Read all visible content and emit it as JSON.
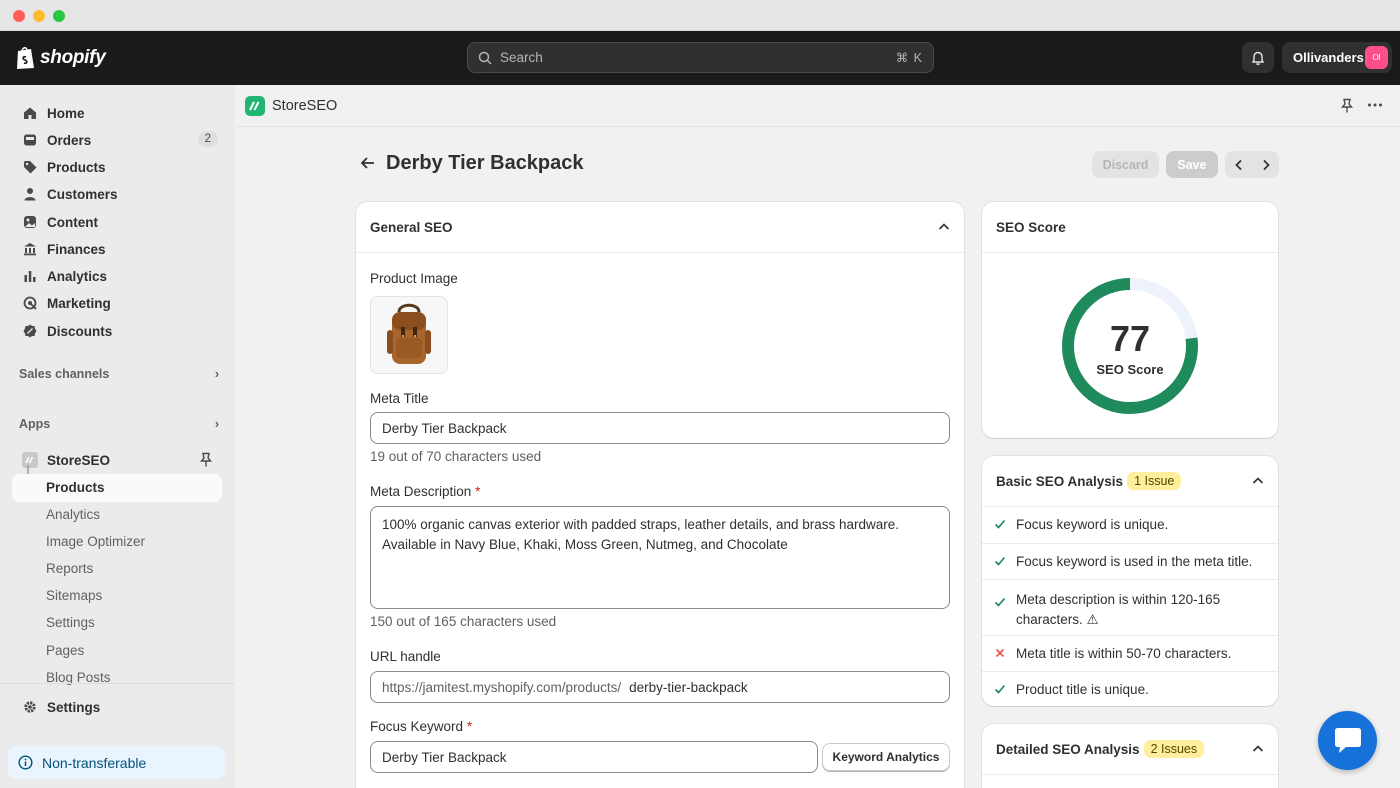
{
  "topbar": {
    "logo_text": "shopify",
    "search_placeholder": "Search",
    "search_shortcut": "⌘ K",
    "store_name": "Ollivanders",
    "avatar_initials": "Ol"
  },
  "sidebar": {
    "items": [
      {
        "label": "Home",
        "icon": "home-icon"
      },
      {
        "label": "Orders",
        "icon": "orders-icon",
        "badge": "2"
      },
      {
        "label": "Products",
        "icon": "tag-icon"
      },
      {
        "label": "Customers",
        "icon": "person-icon"
      },
      {
        "label": "Content",
        "icon": "content-icon"
      },
      {
        "label": "Finances",
        "icon": "bank-icon"
      },
      {
        "label": "Analytics",
        "icon": "bar-chart-icon"
      },
      {
        "label": "Marketing",
        "icon": "target-icon"
      },
      {
        "label": "Discounts",
        "icon": "discount-icon"
      }
    ],
    "sales_channels": "Sales channels",
    "apps": "Apps",
    "app_name": "StoreSEO",
    "app_subitems": [
      "Products",
      "Analytics",
      "Image Optimizer",
      "Reports",
      "Sitemaps",
      "Settings",
      "Pages",
      "Blog Posts"
    ],
    "settings": "Settings",
    "non_transferable": "Non-transferable"
  },
  "app_header": {
    "title": "StoreSEO"
  },
  "page": {
    "title": "Derby Tier Backpack",
    "discard": "Discard",
    "save": "Save"
  },
  "general_seo": {
    "heading": "General SEO",
    "product_image_label": "Product Image",
    "meta_title_label": "Meta Title",
    "meta_title_value": "Derby Tier Backpack",
    "meta_title_help": "19 out of 70 characters used",
    "meta_desc_label": "Meta Description",
    "meta_desc_value": "100% organic canvas exterior with padded straps, leather details, and brass hardware. Available in Navy Blue, Khaki, Moss Green, Nutmeg, and Chocolate",
    "meta_desc_help": "150 out of 165 characters used",
    "url_label": "URL handle",
    "url_prefix": "https://jamitest.myshopify.com/products/",
    "url_value": "derby-tier-backpack",
    "focus_label": "Focus Keyword",
    "focus_value": "Derby Tier Backpack",
    "keyword_btn": "Keyword Analytics",
    "required_mark": "*"
  },
  "seo_score": {
    "heading": "SEO Score",
    "value": "77",
    "label": "SEO Score",
    "fraction": 0.77,
    "color": "#1f8a5b"
  },
  "basic_analysis": {
    "heading": "Basic SEO Analysis",
    "badge": "1 Issue",
    "checks": [
      {
        "text": "Focus keyword is unique.",
        "status": "pass"
      },
      {
        "text": "Focus keyword is used in the meta title.",
        "status": "pass"
      },
      {
        "text": "Meta description is within 120-165 characters.",
        "status": "pass",
        "warning": "⚠"
      },
      {
        "text": "Meta title is within 50-70 characters.",
        "status": "fail"
      },
      {
        "text": "Product title is unique.",
        "status": "pass"
      }
    ]
  },
  "detailed_analysis": {
    "heading": "Detailed SEO Analysis",
    "badge": "2 Issues"
  }
}
